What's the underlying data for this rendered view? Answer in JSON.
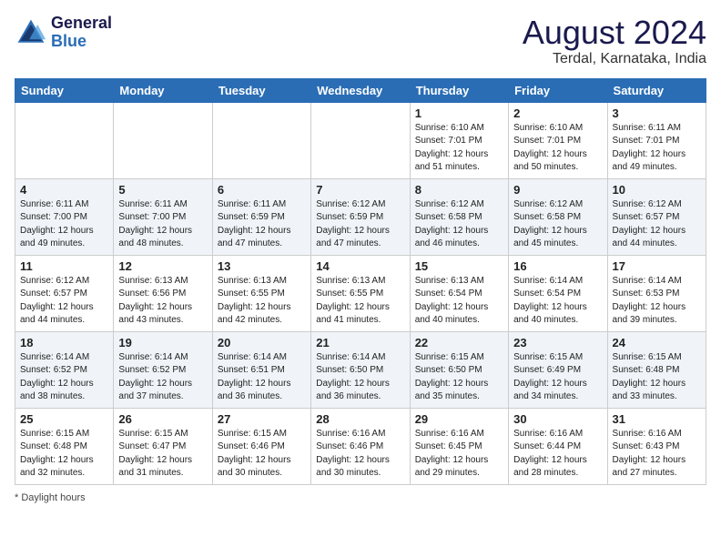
{
  "header": {
    "logo_line1": "General",
    "logo_line2": "Blue",
    "month": "August 2024",
    "location": "Terdal, Karnataka, India"
  },
  "weekdays": [
    "Sunday",
    "Monday",
    "Tuesday",
    "Wednesday",
    "Thursday",
    "Friday",
    "Saturday"
  ],
  "weeks": [
    [
      {
        "day": "",
        "content": ""
      },
      {
        "day": "",
        "content": ""
      },
      {
        "day": "",
        "content": ""
      },
      {
        "day": "",
        "content": ""
      },
      {
        "day": "1",
        "content": "Sunrise: 6:10 AM\nSunset: 7:01 PM\nDaylight: 12 hours\nand 51 minutes."
      },
      {
        "day": "2",
        "content": "Sunrise: 6:10 AM\nSunset: 7:01 PM\nDaylight: 12 hours\nand 50 minutes."
      },
      {
        "day": "3",
        "content": "Sunrise: 6:11 AM\nSunset: 7:01 PM\nDaylight: 12 hours\nand 49 minutes."
      }
    ],
    [
      {
        "day": "4",
        "content": "Sunrise: 6:11 AM\nSunset: 7:00 PM\nDaylight: 12 hours\nand 49 minutes."
      },
      {
        "day": "5",
        "content": "Sunrise: 6:11 AM\nSunset: 7:00 PM\nDaylight: 12 hours\nand 48 minutes."
      },
      {
        "day": "6",
        "content": "Sunrise: 6:11 AM\nSunset: 6:59 PM\nDaylight: 12 hours\nand 47 minutes."
      },
      {
        "day": "7",
        "content": "Sunrise: 6:12 AM\nSunset: 6:59 PM\nDaylight: 12 hours\nand 47 minutes."
      },
      {
        "day": "8",
        "content": "Sunrise: 6:12 AM\nSunset: 6:58 PM\nDaylight: 12 hours\nand 46 minutes."
      },
      {
        "day": "9",
        "content": "Sunrise: 6:12 AM\nSunset: 6:58 PM\nDaylight: 12 hours\nand 45 minutes."
      },
      {
        "day": "10",
        "content": "Sunrise: 6:12 AM\nSunset: 6:57 PM\nDaylight: 12 hours\nand 44 minutes."
      }
    ],
    [
      {
        "day": "11",
        "content": "Sunrise: 6:12 AM\nSunset: 6:57 PM\nDaylight: 12 hours\nand 44 minutes."
      },
      {
        "day": "12",
        "content": "Sunrise: 6:13 AM\nSunset: 6:56 PM\nDaylight: 12 hours\nand 43 minutes."
      },
      {
        "day": "13",
        "content": "Sunrise: 6:13 AM\nSunset: 6:55 PM\nDaylight: 12 hours\nand 42 minutes."
      },
      {
        "day": "14",
        "content": "Sunrise: 6:13 AM\nSunset: 6:55 PM\nDaylight: 12 hours\nand 41 minutes."
      },
      {
        "day": "15",
        "content": "Sunrise: 6:13 AM\nSunset: 6:54 PM\nDaylight: 12 hours\nand 40 minutes."
      },
      {
        "day": "16",
        "content": "Sunrise: 6:14 AM\nSunset: 6:54 PM\nDaylight: 12 hours\nand 40 minutes."
      },
      {
        "day": "17",
        "content": "Sunrise: 6:14 AM\nSunset: 6:53 PM\nDaylight: 12 hours\nand 39 minutes."
      }
    ],
    [
      {
        "day": "18",
        "content": "Sunrise: 6:14 AM\nSunset: 6:52 PM\nDaylight: 12 hours\nand 38 minutes."
      },
      {
        "day": "19",
        "content": "Sunrise: 6:14 AM\nSunset: 6:52 PM\nDaylight: 12 hours\nand 37 minutes."
      },
      {
        "day": "20",
        "content": "Sunrise: 6:14 AM\nSunset: 6:51 PM\nDaylight: 12 hours\nand 36 minutes."
      },
      {
        "day": "21",
        "content": "Sunrise: 6:14 AM\nSunset: 6:50 PM\nDaylight: 12 hours\nand 36 minutes."
      },
      {
        "day": "22",
        "content": "Sunrise: 6:15 AM\nSunset: 6:50 PM\nDaylight: 12 hours\nand 35 minutes."
      },
      {
        "day": "23",
        "content": "Sunrise: 6:15 AM\nSunset: 6:49 PM\nDaylight: 12 hours\nand 34 minutes."
      },
      {
        "day": "24",
        "content": "Sunrise: 6:15 AM\nSunset: 6:48 PM\nDaylight: 12 hours\nand 33 minutes."
      }
    ],
    [
      {
        "day": "25",
        "content": "Sunrise: 6:15 AM\nSunset: 6:48 PM\nDaylight: 12 hours\nand 32 minutes."
      },
      {
        "day": "26",
        "content": "Sunrise: 6:15 AM\nSunset: 6:47 PM\nDaylight: 12 hours\nand 31 minutes."
      },
      {
        "day": "27",
        "content": "Sunrise: 6:15 AM\nSunset: 6:46 PM\nDaylight: 12 hours\nand 30 minutes."
      },
      {
        "day": "28",
        "content": "Sunrise: 6:16 AM\nSunset: 6:46 PM\nDaylight: 12 hours\nand 30 minutes."
      },
      {
        "day": "29",
        "content": "Sunrise: 6:16 AM\nSunset: 6:45 PM\nDaylight: 12 hours\nand 29 minutes."
      },
      {
        "day": "30",
        "content": "Sunrise: 6:16 AM\nSunset: 6:44 PM\nDaylight: 12 hours\nand 28 minutes."
      },
      {
        "day": "31",
        "content": "Sunrise: 6:16 AM\nSunset: 6:43 PM\nDaylight: 12 hours\nand 27 minutes."
      }
    ]
  ],
  "footer": "Daylight hours"
}
